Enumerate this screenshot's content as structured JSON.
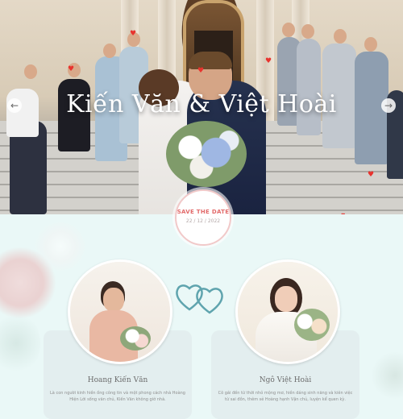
{
  "hero": {
    "title": "Kiến Văn & Việt Hoài",
    "prev_arrow": "←",
    "next_arrow": "→"
  },
  "save_the_date": {
    "title": "SAVE THE DATE",
    "date": "22 / 12 / 2022"
  },
  "groom": {
    "name": "Hoang Kiến Văn",
    "bio": "Là con người kinh hiền ống công tin và một phong cách nhà Hoàng Hiện Lời sống văn chủ, Kiến Văn không giờ nhà."
  },
  "bride": {
    "name": "Ngô Việt Hoài",
    "bio": "Cô gái đến từ thời nhỏ mộng mơ, hiền dáng sinh năng và kiên việc từ sai đồn, thêm sẻ Hoàng hạnh Vận chủ, luyện kể quen kỳ."
  },
  "colors": {
    "accent": "#e26a6a",
    "heart": "#e8332e",
    "section_bg": "#eaf8f7",
    "card_bg": "#e2eced",
    "hearts_icon": "#5fa4ae"
  },
  "icons": [
    "heart-icon",
    "hearts-icon",
    "arrow-left-icon",
    "arrow-right-icon"
  ]
}
